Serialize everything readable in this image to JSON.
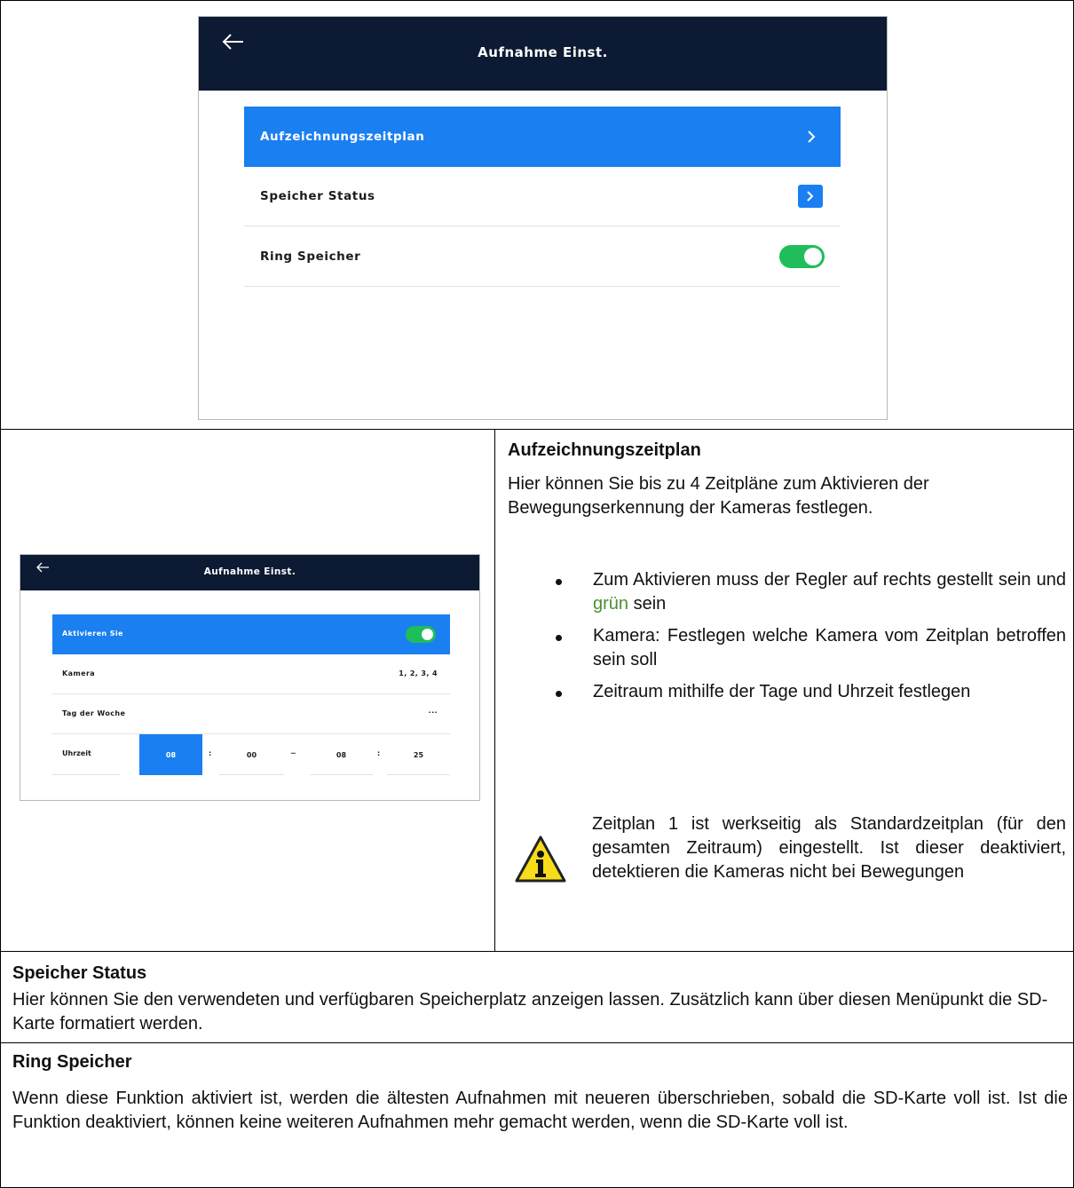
{
  "screen1": {
    "title": "Aufnahme Einst.",
    "back_icon": "arrow-left-icon",
    "rows": [
      {
        "label": "Aufzeichnungszeitplan",
        "control": "chevron-right-icon",
        "active": true
      },
      {
        "label": "Speicher Status",
        "control": "chevron-right-icon"
      },
      {
        "label": "Ring Speicher",
        "control": "toggle",
        "toggle_on": true
      }
    ],
    "colors": {
      "header": "#0c1a33",
      "accent": "#1a7ff0",
      "toggle_on": "#1fbe5a"
    }
  },
  "screen2": {
    "title": "Aufnahme Einst.",
    "back_icon": "arrow-left-icon",
    "rows": {
      "activate": {
        "label": "Aktivieren Sie",
        "toggle_on": true
      },
      "camera": {
        "label": "Kamera",
        "value": "1, 2, 3, 4"
      },
      "weekday": {
        "label": "Tag der Woche",
        "value": "..."
      },
      "time": {
        "label": "Uhrzeit",
        "start_hour": "08",
        "sep1": ":",
        "start_min": "00",
        "range": "~",
        "end_hour": "08",
        "sep2": ":",
        "end_min": "25"
      }
    }
  },
  "section_schedule": {
    "heading": "Aufzeichnungszeitplan",
    "intro": "Hier können Sie bis zu 4 Zeitpläne zum Aktivieren der Bewegungserkennung der Kameras festlegen.",
    "bullets": [
      {
        "before": "Zum Aktivieren muss der Regler auf rechts gestellt sein und ",
        "highlight": "grün",
        "after": " sein"
      },
      {
        "text": "Kamera: Festlegen welche Kamera vom Zeitplan betroffen sein soll"
      },
      {
        "text": "Zeitraum mithilfe der Tage und Uhrzeit festlegen"
      }
    ],
    "info_icon": "info-warning-icon",
    "note": "Zeitplan 1 ist werkseitig als Standardzeitplan (für den gesamten Zeitraum) eingestellt. Ist dieser deaktiviert, detektieren die Kameras nicht bei Bewegungen",
    "highlight_color": "#4f8f32"
  },
  "section_storage": {
    "heading": "Speicher Status",
    "text": "Hier können Sie den verwendeten und verfügbaren Speicherplatz anzeigen lassen. Zusätzlich kann über diesen Menüpunkt die SD-Karte formatiert werden."
  },
  "section_ring": {
    "heading": "Ring Speicher",
    "text": "Wenn diese Funktion aktiviert ist, werden die ältesten Aufnahmen mit neueren überschrieben, sobald die SD-Karte voll ist. Ist die Funktion deaktiviert, können keine weiteren Aufnahmen mehr gemacht werden, wenn die SD-Karte voll ist."
  }
}
